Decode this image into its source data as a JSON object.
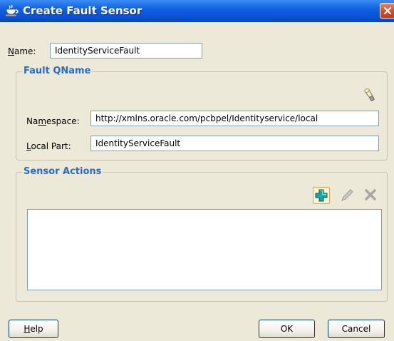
{
  "window": {
    "title": "Create Fault Sensor",
    "title_icon": "coffee-cup-icon",
    "close_icon": "close-icon"
  },
  "name": {
    "label_prefix": "",
    "label_mnemonic": "N",
    "label_rest": "ame:",
    "value": "IdentityServiceFault"
  },
  "fault_qname": {
    "title": "Fault QName",
    "browse_icon": "flashlight-icon",
    "namespace": {
      "label_prefix": "Na",
      "label_mnemonic": "m",
      "label_rest": "espace:",
      "value": "http://xmlns.oracle.com/pcbpel/Identityservice/local"
    },
    "local_part": {
      "label_prefix": "",
      "label_mnemonic": "L",
      "label_rest": "ocal Part:",
      "value": "IdentityServiceFault"
    }
  },
  "sensor_actions": {
    "title": "Sensor Actions",
    "toolbar": [
      "add-icon",
      "edit-icon",
      "delete-icon"
    ],
    "items": []
  },
  "buttons": {
    "help_prefix": "",
    "help_mnemonic": "H",
    "help_rest": "elp",
    "ok": "OK",
    "cancel": "Cancel"
  },
  "colors": {
    "titlebar": "#0a55d8",
    "group_title": "#2a6ac8",
    "add_icon": "#19a6a0"
  }
}
